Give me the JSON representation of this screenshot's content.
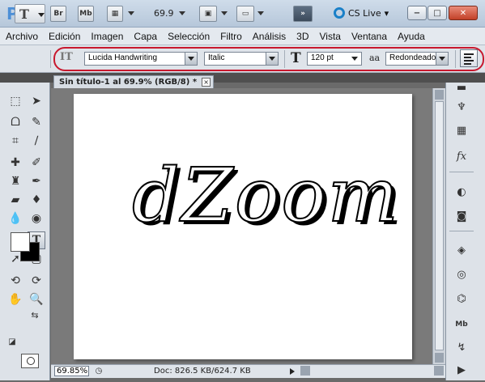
{
  "appbar": {
    "logo": "Ps",
    "bridge": "Br",
    "minibridge": "Mb",
    "zoom": "69.9",
    "cs_live": "CS Live",
    "window_buttons": [
      "−",
      "□",
      "✕"
    ]
  },
  "menu": [
    "Archivo",
    "Edición",
    "Imagen",
    "Capa",
    "Selección",
    "Filtro",
    "Análisis",
    "3D",
    "Vista",
    "Ventana",
    "Ayuda"
  ],
  "options": {
    "font_family": "Lucida Handwriting",
    "font_style": "Italic",
    "font_size": "120 pt",
    "antialias_icon": "aa",
    "antialias": "Redondeado",
    "size_icon": "T",
    "orient_icon": "IT",
    "preset_icon": "T"
  },
  "document": {
    "tab_title": "Sin título-1 al 69.9% (RGB/8) *",
    "close": "×",
    "text": "dZoom"
  },
  "status": {
    "zoom": "69.85%",
    "doc_info": "Doc: 826.5 KB/624.7 KB"
  },
  "colors": {
    "foreground": "#ffffff",
    "background": "#000000",
    "highlight": "#c8182e"
  }
}
